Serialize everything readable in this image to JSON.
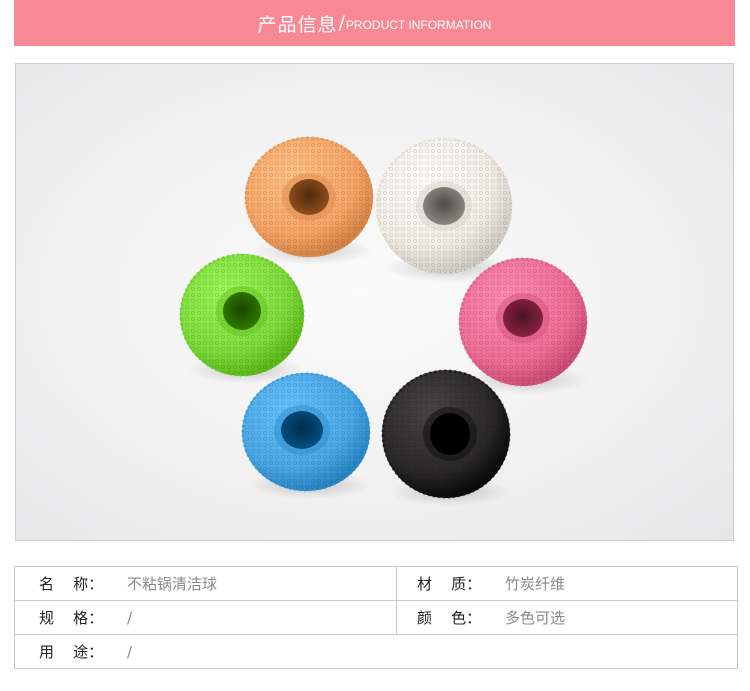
{
  "header": {
    "title_cn": "产品信息",
    "separator": "/",
    "title_en": "PRODUCT INFORMATION"
  },
  "photo": {
    "subject": "colored scrubber balls",
    "colors": [
      "#f7a668",
      "#f2ede4",
      "#7fdc3c",
      "#ef6f98",
      "#4aa7e6",
      "#2a2828"
    ]
  },
  "specs": {
    "name_label": "名    称：",
    "name_value": "不粘锅清洁球",
    "material_label": "材    质：",
    "material_value": "竹炭纤维",
    "size_label": "规    格：",
    "size_value": "/",
    "color_label": "颜    色：",
    "color_value": "多色可选",
    "use_label": "用    途：",
    "use_value": "/"
  }
}
